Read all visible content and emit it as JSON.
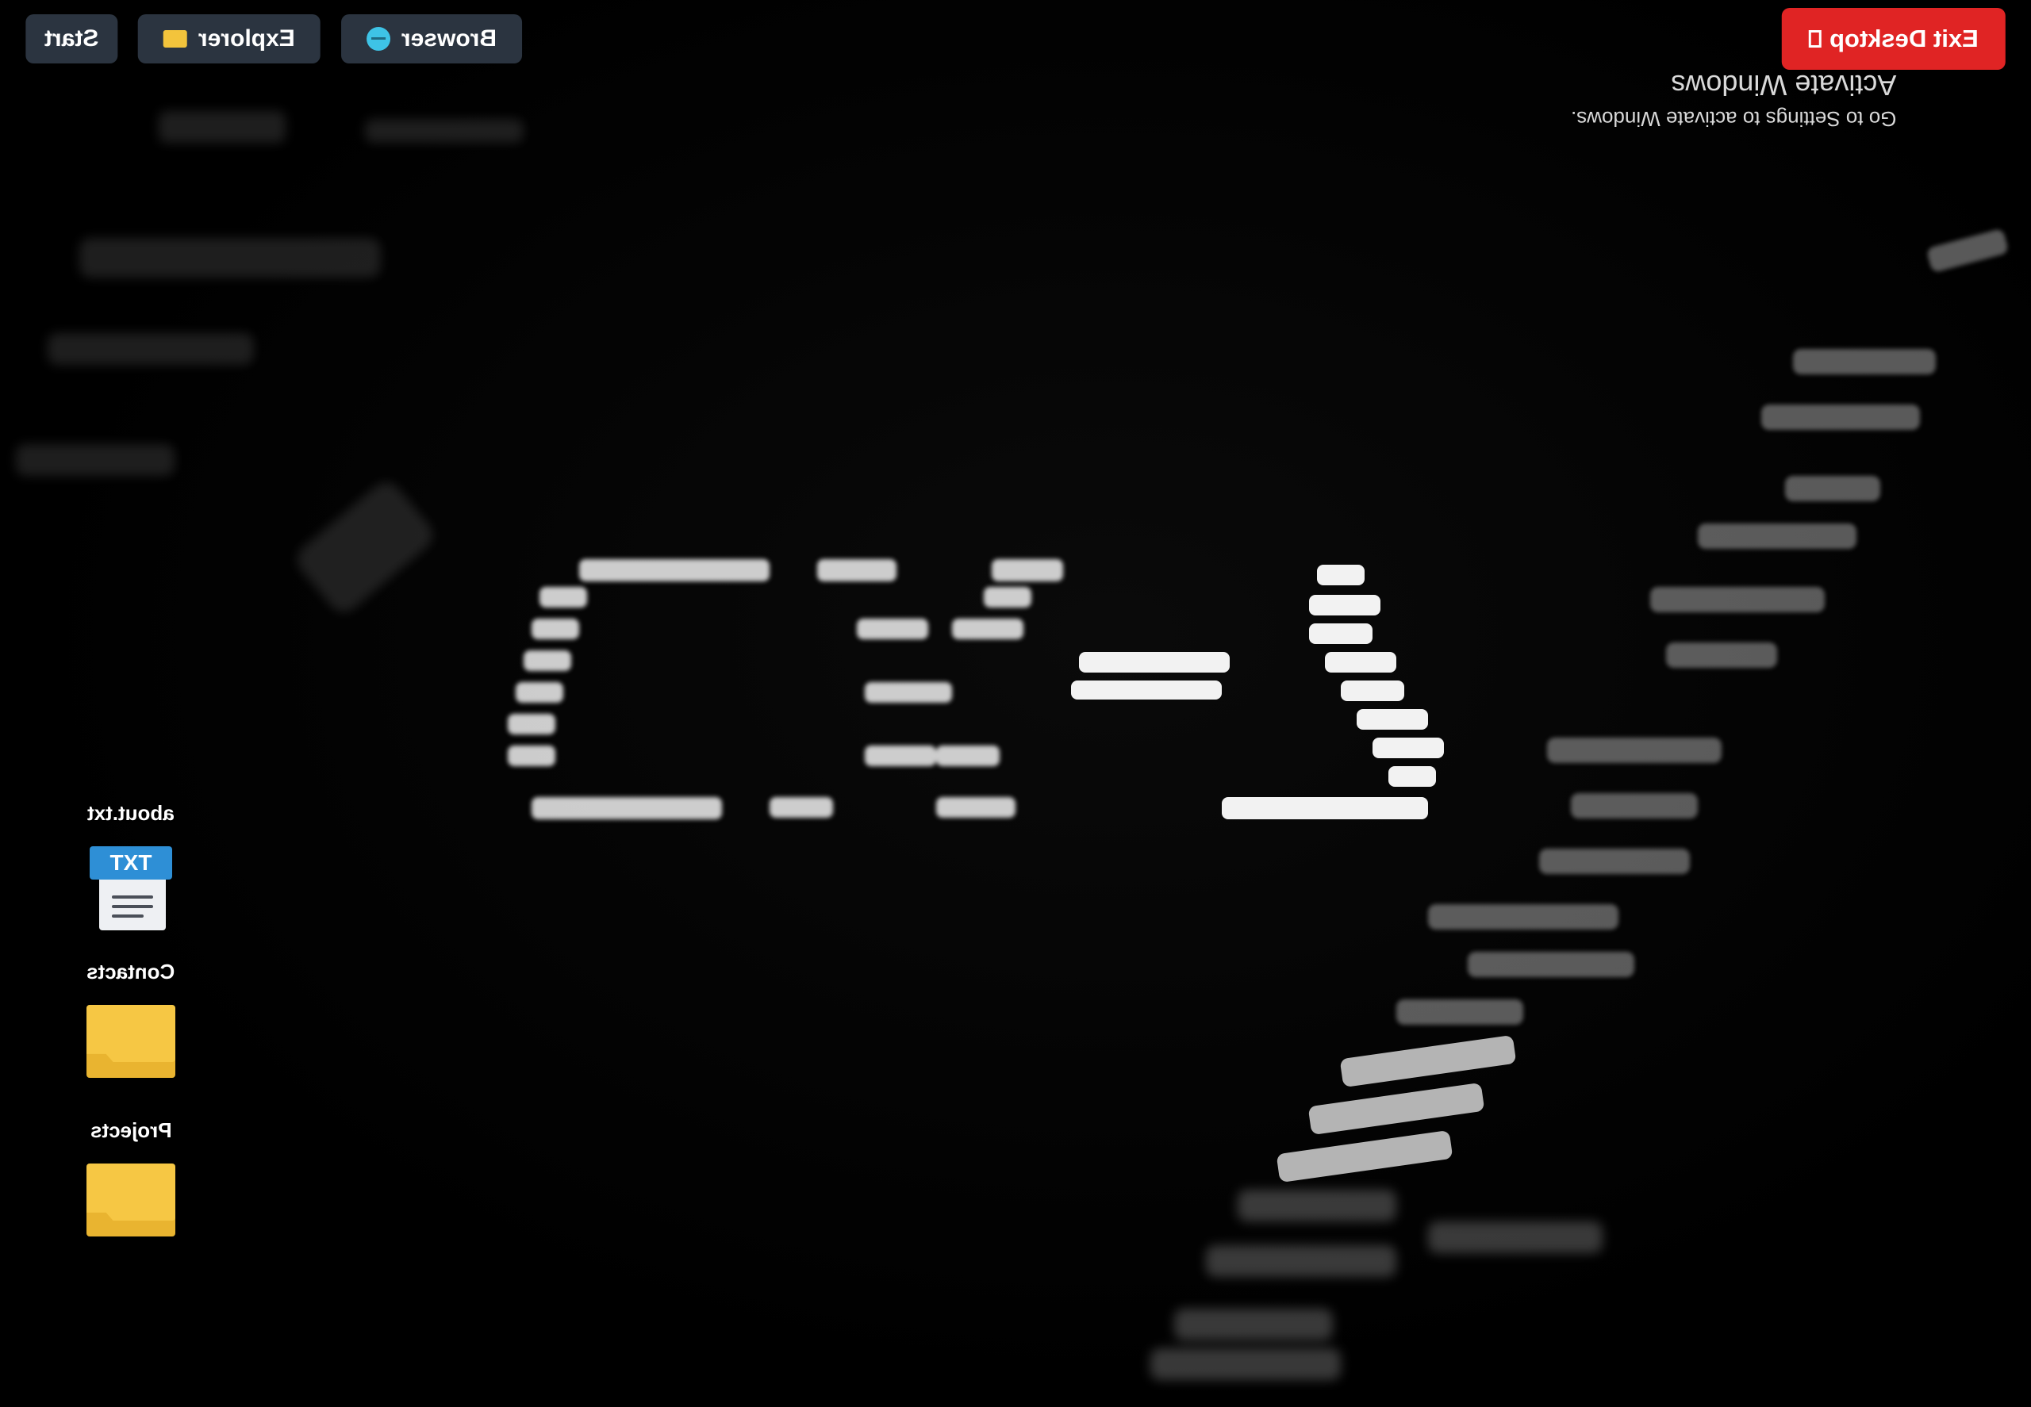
{
  "taskbar": {
    "start_label": "Start",
    "explorer_label": "Explorer",
    "browser_label": "Browser"
  },
  "exit": {
    "label": "Exit Desktop"
  },
  "watermark": {
    "title": "Activate Windows",
    "subtitle": "Go to Settings to activate Windows."
  },
  "desktop_icons": [
    {
      "label": "about.txt",
      "type": "text-file",
      "badge": "TXT"
    },
    {
      "label": "Contacts",
      "type": "folder"
    },
    {
      "label": "Projects",
      "type": "folder"
    }
  ],
  "wallpaper": {
    "logo_text": "CX-λ",
    "style": "matrix-digits",
    "colors": {
      "background": "#000000",
      "digits": "#ffffff"
    }
  },
  "colors": {
    "toolbar_button": "#2b3440",
    "exit_button": "#e02424",
    "folder": "#f6c744",
    "txt_badge": "#2e8fd6"
  }
}
